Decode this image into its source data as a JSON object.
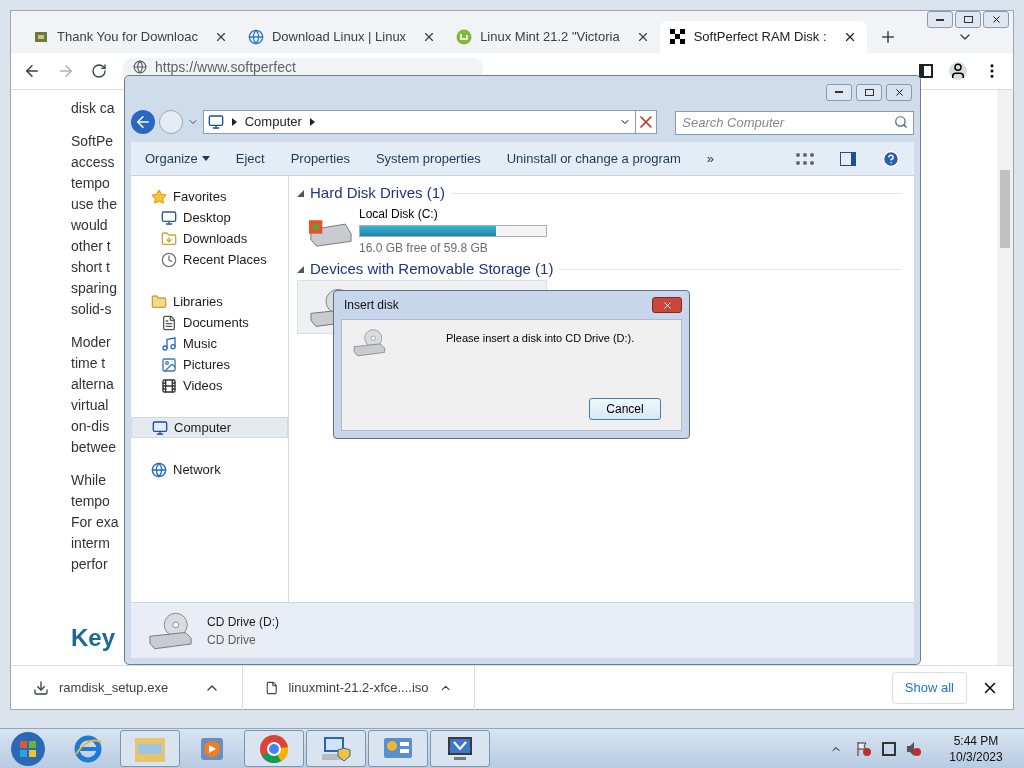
{
  "browser": {
    "tabs": [
      {
        "title": "Thank You for Downloac",
        "selected": false
      },
      {
        "title": "Download Linux | Linux",
        "selected": false
      },
      {
        "title": "Linux Mint 21.2 \"Victoria",
        "selected": false
      },
      {
        "title": "SoftPerfect RAM Disk :",
        "selected": true
      }
    ],
    "address": "https://www.softperfect",
    "page_lines": [
      [
        "disk ca"
      ],
      [
        "SoftPe",
        "access",
        "tempo",
        "use the",
        "would",
        "other t",
        "short t",
        "sparing",
        "solid-s"
      ],
      [
        "Moder",
        "time t",
        "alterna",
        "virtual",
        "on-dis",
        "betwee"
      ],
      [
        "While",
        "tempo",
        "For exa",
        "interm",
        "perfor"
      ]
    ],
    "heading": "Key",
    "downloads": [
      {
        "filename": "ramdisk_setup.exe"
      },
      {
        "filename": "linuxmint-21.2-xfce....iso"
      }
    ],
    "show_all": "Show all"
  },
  "explorer": {
    "path": "Computer",
    "search_placeholder": "Search Computer",
    "toolbar": [
      "Organize",
      "Eject",
      "Properties",
      "System properties",
      "Uninstall or change a program",
      "»"
    ],
    "nav": [
      {
        "label": "Favorites",
        "selected": false,
        "children": [
          {
            "label": "Desktop",
            "selected": false
          },
          {
            "label": "Downloads",
            "selected": false
          },
          {
            "label": "Recent Places",
            "selected": false
          }
        ]
      },
      {
        "label": "Libraries",
        "selected": false,
        "children": [
          {
            "label": "Documents",
            "selected": false
          },
          {
            "label": "Music",
            "selected": false
          },
          {
            "label": "Pictures",
            "selected": false
          },
          {
            "label": "Videos",
            "selected": false
          }
        ]
      },
      {
        "label": "Computer",
        "selected": true
      },
      {
        "label": "Network",
        "selected": false
      }
    ],
    "sections": [
      {
        "title": "Hard Disk Drives (1)",
        "drives": [
          {
            "kind": "disk",
            "name": "Local Disk (C:)",
            "level": 0.73,
            "free": "16.0 GB free of 59.8 GB"
          }
        ]
      },
      {
        "title": "Devices with Removable Storage (1)",
        "drives": [
          {
            "kind": "cd"
          }
        ]
      }
    ],
    "details": {
      "name": "CD Drive (D:)",
      "type": "CD Drive"
    }
  },
  "dialog": {
    "title": "Insert disk",
    "message": "Please insert a disk into CD Drive (D:).",
    "button": "Cancel"
  },
  "taskbar": {
    "apps": [
      {
        "open": false
      },
      {
        "open": true
      },
      {
        "open": false
      },
      {
        "open": true
      },
      {
        "open": true
      },
      {
        "open": true
      },
      {
        "open": true
      }
    ],
    "time": "5:44 PM",
    "date": "10/3/2023"
  }
}
